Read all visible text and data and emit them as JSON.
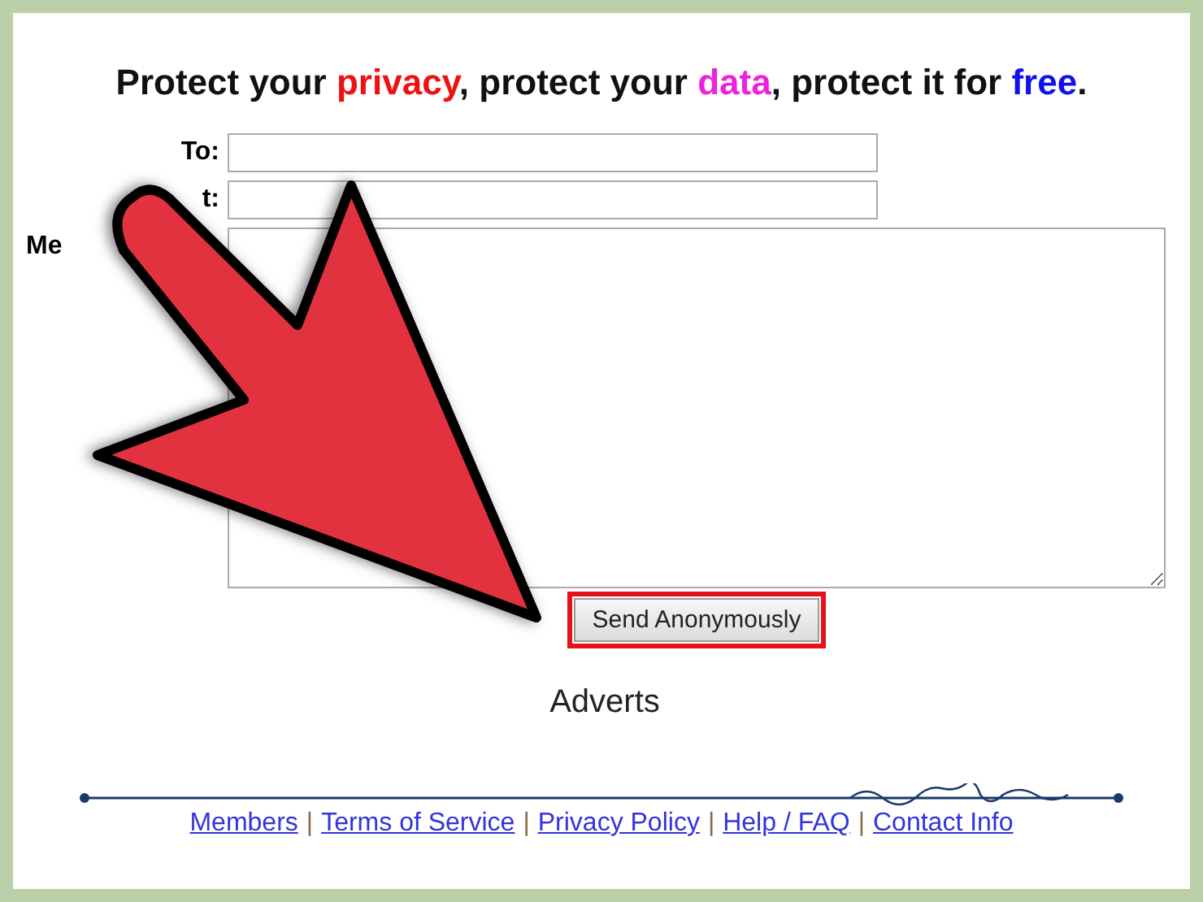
{
  "headline": [
    {
      "text": "Protect your ",
      "color": "#111111"
    },
    {
      "text": "privacy",
      "color": "#ee1111"
    },
    {
      "text": ", protect your ",
      "color": "#111111"
    },
    {
      "text": "data",
      "color": "#ee22dd"
    },
    {
      "text": ", protect it for ",
      "color": "#111111"
    },
    {
      "text": "free",
      "color": "#1111ee"
    },
    {
      "text": ".",
      "color": "#111111"
    }
  ],
  "fields": [
    {
      "label": "To:",
      "kind": "line"
    },
    {
      "label": "t:",
      "kind": "line"
    },
    {
      "label": "Me",
      "kind": "area"
    }
  ],
  "send_button": {
    "label": "Send Anonymously",
    "highlighted": true
  },
  "adverts": "Adverts",
  "footer": {
    "separator": "|",
    "links": [
      "Members",
      "Terms of Service",
      "Privacy Policy",
      "Help / FAQ",
      "Contact Info"
    ]
  }
}
